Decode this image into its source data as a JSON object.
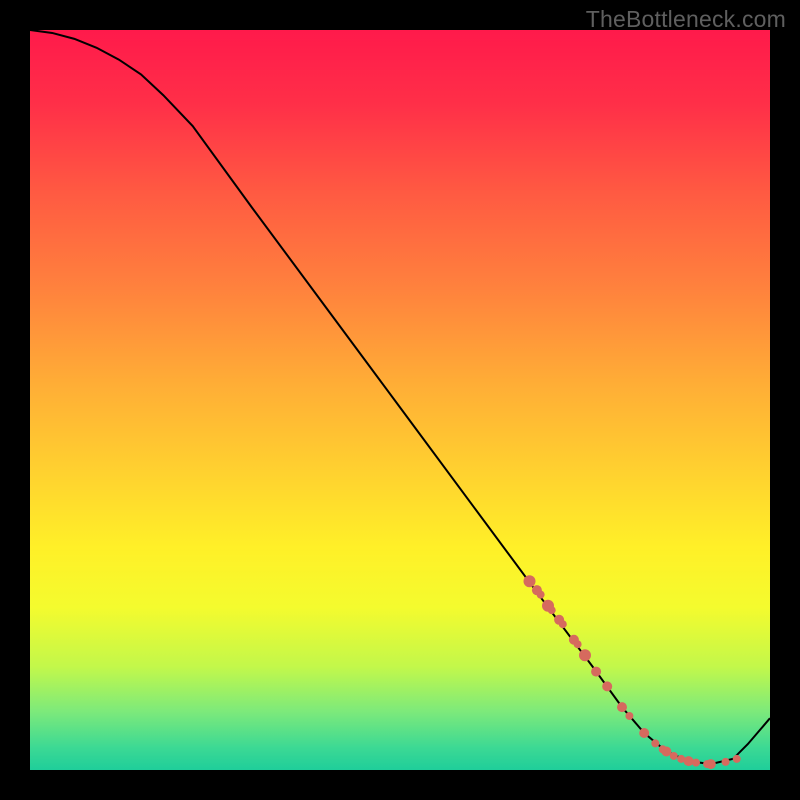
{
  "branding": {
    "watermark": "TheBottleneck.com"
  },
  "chart_data": {
    "type": "line",
    "title": "",
    "xlabel": "",
    "ylabel": "",
    "xlim": [
      0,
      100
    ],
    "ylim": [
      0,
      100
    ],
    "grid": false,
    "legend": false,
    "background_gradient": {
      "direction": "vertical",
      "stops": [
        {
          "offset": 0.0,
          "color": "#ff1a4b"
        },
        {
          "offset": 0.1,
          "color": "#ff2f48"
        },
        {
          "offset": 0.22,
          "color": "#ff5a42"
        },
        {
          "offset": 0.35,
          "color": "#ff823d"
        },
        {
          "offset": 0.48,
          "color": "#ffae36"
        },
        {
          "offset": 0.6,
          "color": "#ffd22f"
        },
        {
          "offset": 0.7,
          "color": "#fff028"
        },
        {
          "offset": 0.78,
          "color": "#f4fb2e"
        },
        {
          "offset": 0.86,
          "color": "#c3f84a"
        },
        {
          "offset": 0.92,
          "color": "#7eea7a"
        },
        {
          "offset": 0.97,
          "color": "#3cd994"
        },
        {
          "offset": 1.0,
          "color": "#1fce9a"
        }
      ]
    },
    "series": [
      {
        "name": "bottleneck-curve",
        "color": "#000000",
        "x": [
          0,
          3,
          6,
          9,
          12,
          15,
          18,
          22,
          30,
          40,
          50,
          60,
          70,
          76,
          80,
          83,
          86,
          89,
          92,
          95,
          97,
          100
        ],
        "y": [
          100.0,
          99.6,
          98.8,
          97.6,
          96.0,
          94.0,
          91.2,
          87.0,
          76.0,
          62.5,
          49.0,
          35.5,
          22.0,
          14.0,
          8.5,
          5.0,
          2.5,
          1.2,
          0.8,
          1.5,
          3.5,
          7.0
        ]
      }
    ],
    "markers": {
      "name": "data-points",
      "color": "#d66a5e",
      "shape": "circle",
      "radius_major": 6,
      "radius_minor": 4,
      "x": [
        67.5,
        68.5,
        69.0,
        70.0,
        70.5,
        71.5,
        72.0,
        73.5,
        74.0,
        75.0,
        76.5,
        78.0,
        80.0,
        81.0,
        83.0,
        84.5,
        85.5,
        86.0,
        87.0,
        88.0,
        89.0,
        90.0,
        91.5,
        92.0,
        94.0,
        95.5
      ],
      "y": [
        25.5,
        24.3,
        23.7,
        22.2,
        21.6,
        20.3,
        19.7,
        17.6,
        17.0,
        15.5,
        13.3,
        11.3,
        8.5,
        7.3,
        5.0,
        3.6,
        2.8,
        2.5,
        1.9,
        1.5,
        1.2,
        1.0,
        0.8,
        0.8,
        1.1,
        1.5
      ],
      "r": [
        6,
        5,
        4,
        6,
        4,
        5,
        4,
        5,
        4,
        6,
        5,
        5,
        5,
        4,
        5,
        4,
        4,
        5,
        4,
        4,
        5,
        4,
        4,
        5,
        4,
        4
      ]
    }
  }
}
